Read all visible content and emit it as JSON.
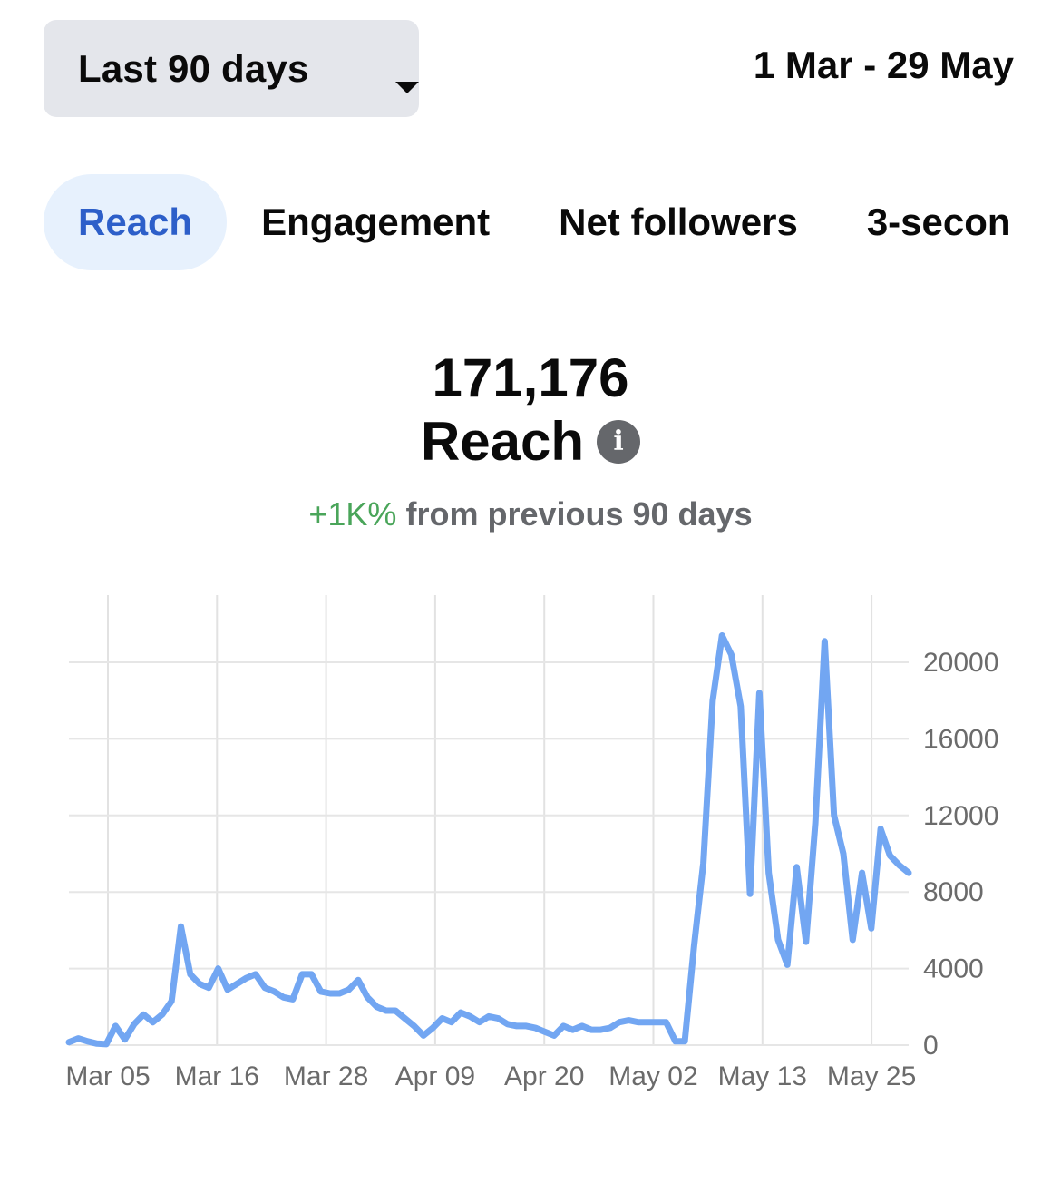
{
  "header": {
    "range_selector": {
      "label": "Last 90 days",
      "icon": "caret-down-icon"
    },
    "date_range": "1 Mar - 29 May"
  },
  "tabs": [
    {
      "label": "Reach",
      "active": true
    },
    {
      "label": "Engagement",
      "active": false
    },
    {
      "label": "Net followers",
      "active": false
    },
    {
      "label": "3-secon",
      "active": false
    }
  ],
  "summary": {
    "value": "171,176",
    "label": "Reach",
    "info_icon": "info-icon",
    "delta": "+1K%",
    "comparison_text": "from previous 90 days"
  },
  "colors": {
    "line": "#72a6f2",
    "active_tab_bg": "#e7f1fd",
    "active_tab_text": "#2d5fc9",
    "delta_text": "#4aa55a",
    "selector_bg": "#e4e6eb"
  },
  "chart_data": {
    "type": "line",
    "title": "",
    "xlabel": "",
    "ylabel": "",
    "ylim": [
      0,
      22000
    ],
    "yticks": [
      0,
      4000,
      8000,
      12000,
      16000,
      20000
    ],
    "y_axis_side": "right",
    "x_tick_labels": [
      "Mar 05",
      "Mar 16",
      "Mar 28",
      "Apr 09",
      "Apr 20",
      "May 02",
      "May 13",
      "May 25"
    ],
    "grid": true,
    "series": [
      {
        "values": [
          150,
          350,
          200,
          80,
          50,
          1000,
          300,
          1100,
          1600,
          1200,
          1600,
          2300,
          6200,
          3700,
          3200,
          3000,
          4000,
          2900,
          3200,
          3500,
          3700,
          3000,
          2800,
          2500,
          2400,
          3700,
          3700,
          2800,
          2700,
          2700,
          2900,
          3400,
          2500,
          2000,
          1800,
          1800,
          1400,
          1000,
          500,
          900,
          1400,
          1200,
          1700,
          1500,
          1200,
          1500,
          1400,
          1100,
          1000,
          1000,
          900,
          700,
          500,
          1000,
          800,
          1000,
          800,
          800,
          900,
          1200,
          1300,
          1200,
          1200,
          1200,
          1200,
          200,
          200,
          5200,
          9500,
          18000,
          21400,
          20400,
          17700,
          7900,
          18400,
          9000,
          5500,
          4200,
          9300,
          5400,
          11600,
          21100,
          12000,
          10000,
          5500,
          9000,
          6100,
          11300,
          9900,
          9400,
          9000
        ]
      }
    ]
  }
}
